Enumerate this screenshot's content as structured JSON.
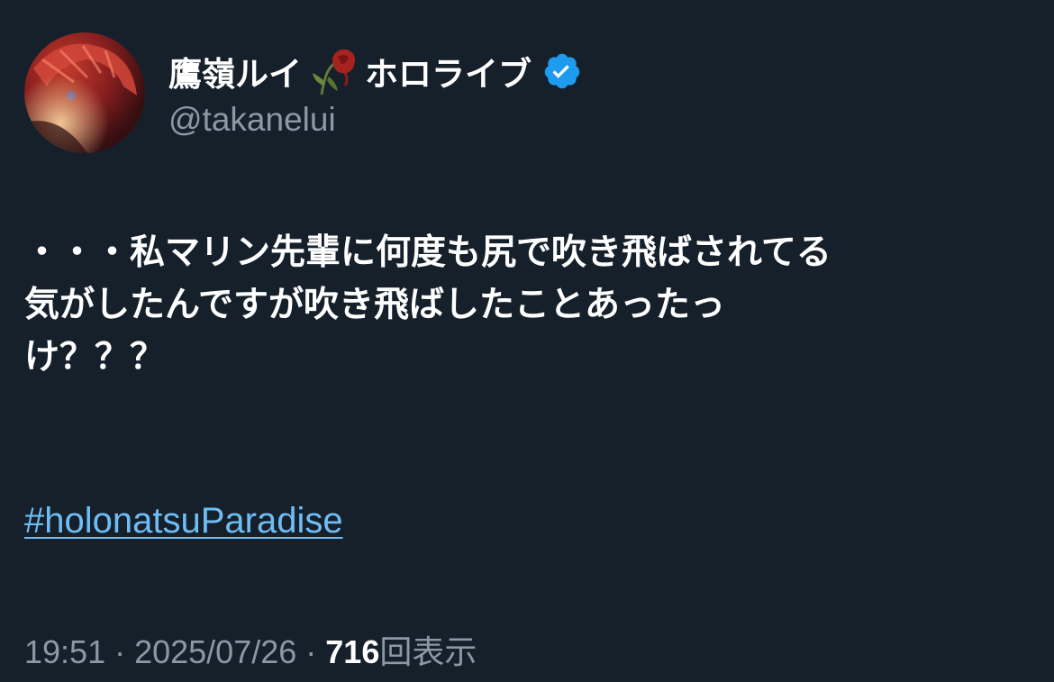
{
  "author": {
    "display_name": "鷹嶺ルイ",
    "display_name_suffix": "ホロライブ",
    "emoji_icon": "wilted-rose-icon",
    "verified": true,
    "verified_icon": "verified-badge-icon",
    "handle": "@takanelui"
  },
  "tweet": {
    "lines": [
      "・・・私マリン先輩に何度も尻で吹き飛ばされてる",
      "気がしたんですが吹き飛ばしたことあったっ",
      "け？？？"
    ],
    "hashtag": "#holonatsuParadise"
  },
  "meta": {
    "time": "19:51",
    "separator": " · ",
    "date": "2025/07/26",
    "views_count": "716",
    "views_label": "回表示"
  },
  "colors": {
    "background": "#15202b",
    "text": "#ffffff",
    "secondary": "#8b98a5",
    "link": "#6fbdf5",
    "verified": "#1d9bf0"
  }
}
